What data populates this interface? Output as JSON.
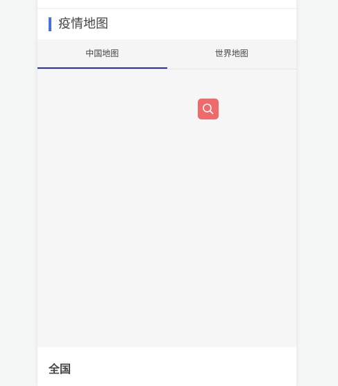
{
  "section": {
    "title": "疫情地图",
    "accent_color": "#4a6fe0"
  },
  "tabs": [
    {
      "label": "中国地图",
      "active": true
    },
    {
      "label": "世界地图",
      "active": false
    }
  ],
  "map": {
    "search_icon": "search-icon",
    "search_button_color": "#ef6b6b"
  },
  "region": {
    "label": "全国"
  }
}
